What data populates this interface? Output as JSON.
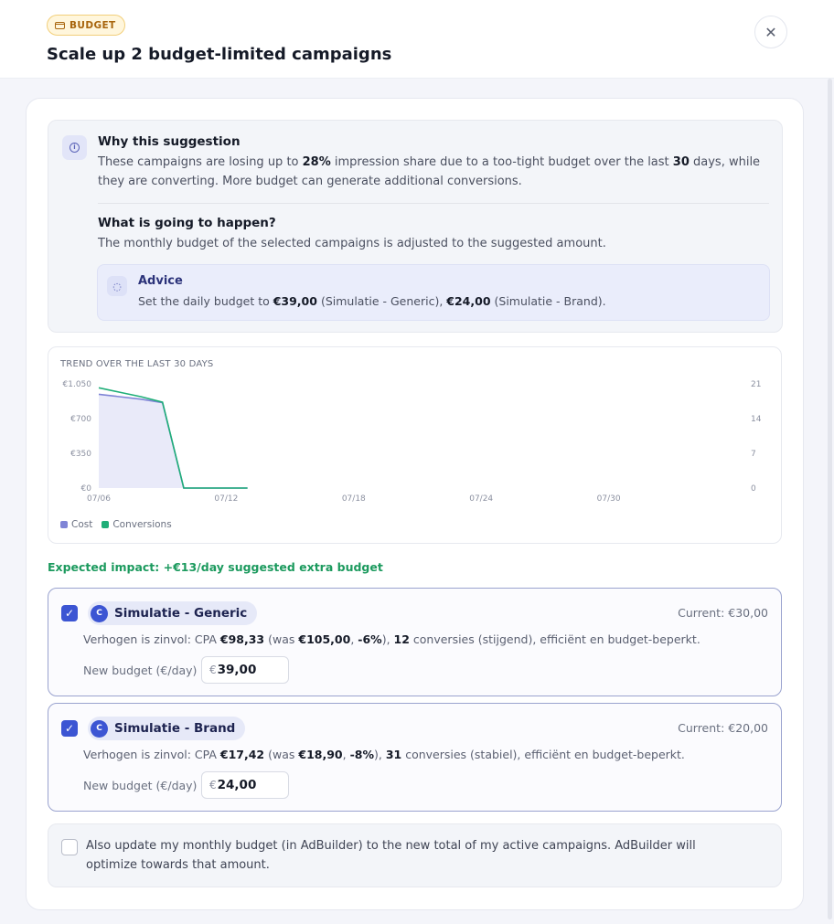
{
  "header": {
    "badge": "BUDGET",
    "title": "Scale up 2 budget-limited campaigns",
    "close_label": "✕"
  },
  "why": {
    "heading": "Why this suggestion",
    "text_1": "These campaigns are losing up to ",
    "pct": "28%",
    "text_2": " impression share due to a too-tight budget over the last ",
    "days": "30",
    "text_3": " days, while they are converting. More budget can generate additional conversions.",
    "happen_heading": "What is going to happen?",
    "happen_text": "The monthly budget of the selected campaigns is adjusted to the suggested amount.",
    "advice_heading": "Advice",
    "advice_1": "Set the daily budget to ",
    "advice_val1": "€39,00",
    "advice_2": " (Simulatie - Generic), ",
    "advice_val2": "€24,00",
    "advice_3": " (Simulatie - Brand)."
  },
  "chart_data": {
    "type": "area",
    "title": "TREND OVER THE LAST 30 DAYS",
    "x_ticks": [
      "07/06",
      "07/12",
      "07/18",
      "07/24",
      "07/30"
    ],
    "y_ticks_left": [
      "€1.050",
      "€700",
      "€350",
      "€0"
    ],
    "y_ticks_right": [
      "21",
      "14",
      "7",
      "0"
    ],
    "ylim_left": [
      0,
      1050
    ],
    "ylim_right": [
      0,
      21
    ],
    "x": [
      "07/06",
      "07/07",
      "07/08",
      "07/09",
      "07/10",
      "07/11",
      "07/12",
      "07/13"
    ],
    "series": [
      {
        "name": "Cost",
        "axis": "left",
        "color": "#7f84d6",
        "values": [
          945,
          920,
          895,
          860,
          0,
          0,
          0,
          0
        ]
      },
      {
        "name": "Conversions",
        "axis": "right",
        "color": "#1fae78",
        "values": [
          20.2,
          19.3,
          18.4,
          17.3,
          0,
          0,
          0,
          0
        ]
      }
    ],
    "legend": "bottom-left"
  },
  "impact": "Expected impact: +€13/day suggested extra budget",
  "campaigns": [
    {
      "initial": "C",
      "name": "Simulatie - Generic",
      "current": "Current: €30,00",
      "reason_1": "Verhogen is zinvol: CPA ",
      "cpa": "€98,33",
      "reason_2": " (was ",
      "was": "€105,00",
      "reason_3": ", ",
      "delta": "-6%",
      "reason_4": "), ",
      "conv": "12",
      "reason_5": " conversies (stijgend), efficiënt en budget-beperkt.",
      "new_budget_label": "New budget (€/day)",
      "currency": "€",
      "new_budget": "39,00"
    },
    {
      "initial": "C",
      "name": "Simulatie - Brand",
      "current": "Current: €20,00",
      "reason_1": "Verhogen is zinvol: CPA ",
      "cpa": "€17,42",
      "reason_2": " (was ",
      "was": "€18,90",
      "reason_3": ", ",
      "delta": "-8%",
      "reason_4": "), ",
      "conv": "31",
      "reason_5": " conversies (stabiel), efficiënt en budget-beperkt.",
      "new_budget_label": "New budget (€/day)",
      "currency": "€",
      "new_budget": "24,00"
    }
  ],
  "update": {
    "text": "Also update my monthly budget (in AdBuilder) to the new total of my active campaigns. AdBuilder will optimize towards that amount."
  }
}
